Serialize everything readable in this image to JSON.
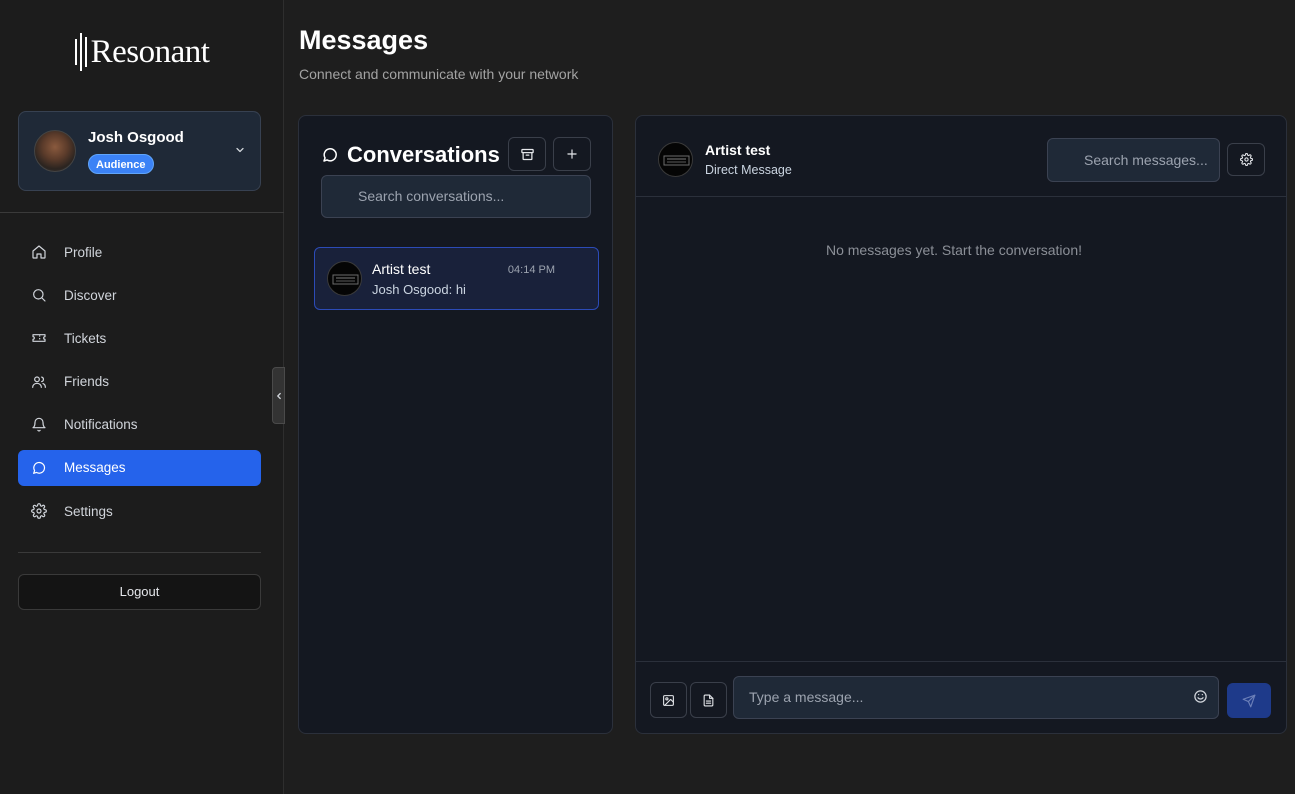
{
  "app": {
    "name": "Resonant"
  },
  "user": {
    "name": "Josh Osgood",
    "role": "Audience"
  },
  "nav": {
    "items": [
      {
        "label": "Profile",
        "icon": "home-icon"
      },
      {
        "label": "Discover",
        "icon": "search-icon"
      },
      {
        "label": "Tickets",
        "icon": "ticket-icon"
      },
      {
        "label": "Friends",
        "icon": "users-icon"
      },
      {
        "label": "Notifications",
        "icon": "bell-icon"
      },
      {
        "label": "Messages",
        "icon": "chat-bubble-icon",
        "active": true
      },
      {
        "label": "Settings",
        "icon": "gear-icon"
      }
    ],
    "logout_label": "Logout"
  },
  "page": {
    "title": "Messages",
    "subtitle": "Connect and communicate with your network"
  },
  "conversations": {
    "title": "Conversations",
    "search_placeholder": "Search conversations...",
    "items": [
      {
        "name": "Artist test",
        "time": "04:14 PM",
        "preview": "Josh Osgood: hi",
        "selected": true
      }
    ]
  },
  "chat": {
    "name": "Artist test",
    "type": "Direct Message",
    "search_placeholder": "Search messages...",
    "empty_text": "No messages yet. Start the conversation!",
    "input_placeholder": "Type a message..."
  },
  "colors": {
    "accent": "#2563eb",
    "badge": "#3b82f6",
    "selected_border": "#2c4bb7",
    "send_button": "#1e3a8a"
  }
}
